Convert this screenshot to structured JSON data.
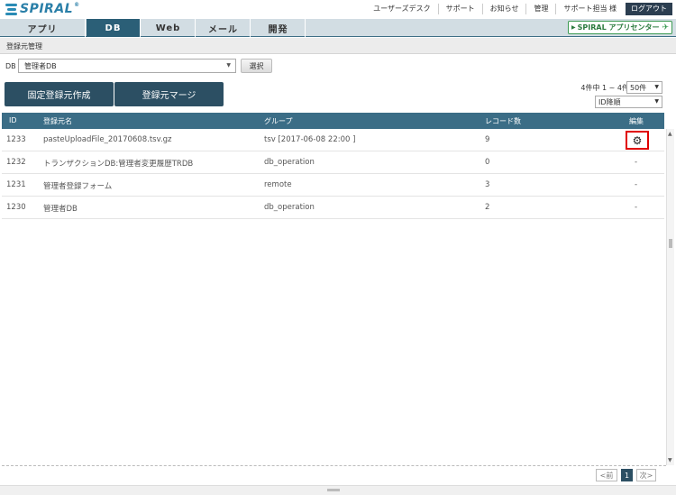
{
  "header": {
    "logo": "SPIRAL",
    "logo_mark": "®",
    "links": [
      "ユーザーズデスク",
      "サポート",
      "お知らせ",
      "管理"
    ],
    "user": "サポート担当 様",
    "logout": "ログアウト"
  },
  "tabs": [
    {
      "label": "アプリ",
      "active": false
    },
    {
      "label": "DB",
      "active": true
    },
    {
      "label": "Web",
      "active": false
    },
    {
      "label": "メール",
      "active": false
    },
    {
      "label": "開発",
      "active": false
    }
  ],
  "appcenter": {
    "label": "SPIRAL アプリセンター",
    "arrow": "▶",
    "icon": "✈"
  },
  "breadcrumb": "登録元管理",
  "db": {
    "label": "DB",
    "selected": "管理者DB",
    "button": "選択"
  },
  "actions": {
    "create": "固定登録元作成",
    "merge": "登録元マージ"
  },
  "listing": {
    "count": "4件中 1 ~ 4件",
    "per_page": "50件",
    "sort": "ID降順"
  },
  "table": {
    "headers": {
      "id": "ID",
      "name": "登録元名",
      "group": "グループ",
      "records": "レコード数",
      "edit": "編集"
    },
    "rows": [
      {
        "id": "1233",
        "name": "pasteUploadFile_20170608.tsv.gz",
        "group": "tsv [2017-06-08 22:00 ]",
        "records": "9",
        "edit": "gear-icon"
      },
      {
        "id": "1232",
        "name": "トランザクションDB:管理者変更履歴TRDB",
        "group": "db_operation",
        "records": "0",
        "edit": "-"
      },
      {
        "id": "1231",
        "name": "管理者登録フォーム",
        "group": "remote",
        "records": "3",
        "edit": "-"
      },
      {
        "id": "1230",
        "name": "管理者DB",
        "group": "db_operation",
        "records": "2",
        "edit": "-"
      }
    ]
  },
  "pagination": {
    "prev": "<前",
    "current": "1",
    "next": "次>"
  },
  "colors": {
    "header_dark": "#2c4f63",
    "table_header": "#3b6d86",
    "tab_active": "#2b5f77",
    "highlight": "#e00000",
    "appcenter": "#3b9a52"
  }
}
